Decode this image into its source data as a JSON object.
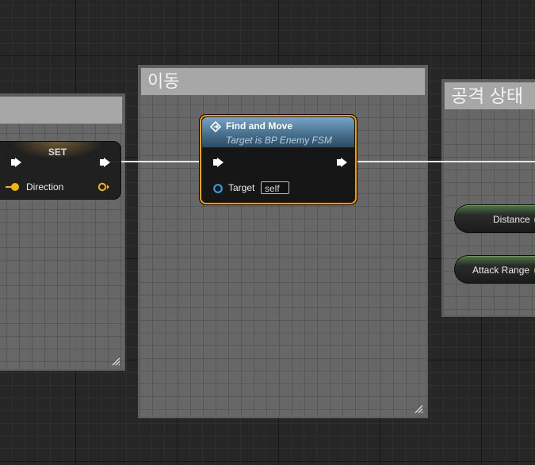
{
  "comments": {
    "left": {
      "title": ""
    },
    "middle": {
      "title": "이동"
    },
    "right": {
      "title": "공격 상태"
    }
  },
  "set_node": {
    "title": "SET",
    "pin_label": "Direction",
    "pin_color": "#f5b800"
  },
  "call_node": {
    "title": "Find and Move",
    "subtitle": "Target is BP Enemy FSM",
    "target_label": "Target",
    "target_value": "self",
    "border_color": "#f3a000",
    "icon": "function-icon"
  },
  "variables": {
    "distance": {
      "label": "Distance"
    },
    "attack_range": {
      "label": "Attack Range"
    },
    "pin_color": "#6ccf48"
  },
  "colors": {
    "background": "#262626",
    "comment_fill": "#767676",
    "comment_title": "#a7a7a7",
    "exec_wire": "#e8e8e8"
  }
}
